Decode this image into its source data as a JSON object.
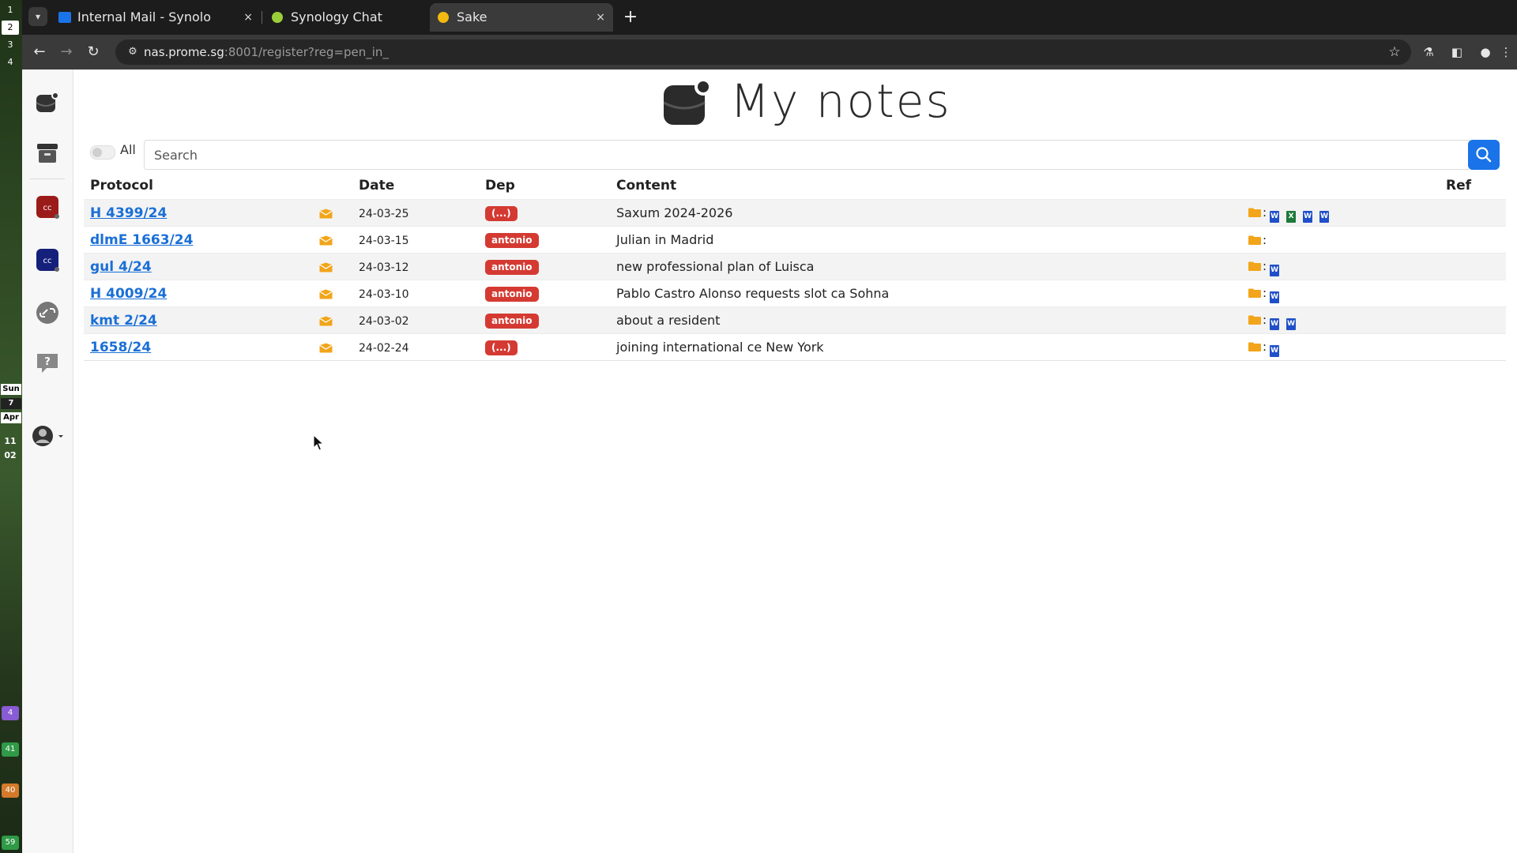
{
  "desktop": {
    "workspaces": [
      "1",
      "2",
      "3",
      "4"
    ],
    "active_workspace": "2",
    "calendar": {
      "day": "Sun",
      "date": "7",
      "month": "Apr"
    },
    "clock": {
      "hour": "11",
      "minute": "02"
    },
    "tray": [
      {
        "label": "4",
        "color": "#8a5bd6"
      },
      {
        "label": "41",
        "color": "#2f9a47"
      },
      {
        "label": "40",
        "color": "#d47a2a"
      },
      {
        "label": "59",
        "color": "#2f9a47"
      }
    ]
  },
  "browser": {
    "tabs": [
      {
        "title": "Internal Mail - Synolo",
        "favicon_color": "#1a73e8",
        "active": false
      },
      {
        "title": "Synology Chat",
        "favicon_color": "#9bcf3a",
        "active": false
      },
      {
        "title": "Sake",
        "favicon_color": "#f2b90f",
        "active": true
      }
    ],
    "close_glyph": "×",
    "new_tab_glyph": "+",
    "url_host": "nas.prome.sg",
    "url_path": ":8001/register?reg=pen_in_"
  },
  "app": {
    "title": "My notes",
    "toggle_label": "All",
    "search_placeholder": "Search",
    "columns": {
      "protocol": "Protocol",
      "date": "Date",
      "dep": "Dep",
      "content": "Content",
      "ref": "Ref"
    },
    "rows": [
      {
        "protocol": "H 4399/24",
        "date": "24-03-25",
        "dep": "(...)",
        "content": "Saxum 2024-2026",
        "docs": [
          "W",
          "X",
          "W",
          "W"
        ]
      },
      {
        "protocol": "dlmE 1663/24",
        "date": "24-03-15",
        "dep": "antonio",
        "content": "Julian in Madrid",
        "docs": []
      },
      {
        "protocol": "gul 4/24",
        "date": "24-03-12",
        "dep": "antonio",
        "content": "new professional plan of Luisca",
        "docs": [
          "W"
        ]
      },
      {
        "protocol": "H 4009/24",
        "date": "24-03-10",
        "dep": "antonio",
        "content": "Pablo Castro Alonso requests slot ca Sohna",
        "docs": [
          "W"
        ]
      },
      {
        "protocol": "kmt 2/24",
        "date": "24-03-02",
        "dep": "antonio",
        "content": "about a resident",
        "docs": [
          "W",
          "W"
        ]
      },
      {
        "protocol": "1658/24",
        "date": "24-02-24",
        "dep": "(...)",
        "content": "joining international ce New York",
        "docs": [
          "W"
        ]
      }
    ],
    "ref_separator": ":",
    "colors": {
      "accent": "#1a73e8",
      "badge": "#d43a32",
      "link": "#1a6fd6",
      "folder": "#f2a51a",
      "word": "#1f4fc9",
      "excel": "#1d7a3a"
    }
  }
}
